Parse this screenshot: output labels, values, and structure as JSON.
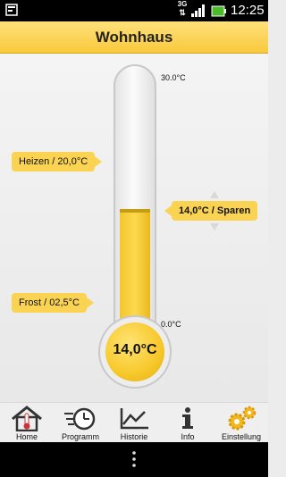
{
  "status_bar": {
    "network": "3G",
    "time": "12:25"
  },
  "title": "Wohnhaus",
  "thermometer": {
    "max_label": "30.0°C",
    "min_label": "0.0°C",
    "current": "14,0°C",
    "current_value": 14.0,
    "scale_min": 0.0,
    "scale_max": 30.0,
    "fill_color": "#fbd352"
  },
  "labels": {
    "heizen": "Heizen / 20,0°C",
    "sparen": "14,0°C / Sparen",
    "frost": "Frost / 02,5°C"
  },
  "nav": [
    {
      "label": "Home",
      "icon": "home-thermometer-icon"
    },
    {
      "label": "Programm",
      "icon": "clock-program-icon"
    },
    {
      "label": "Historie",
      "icon": "chart-history-icon"
    },
    {
      "label": "Info",
      "icon": "info-icon"
    },
    {
      "label": "Einstellung",
      "icon": "gears-icon"
    }
  ]
}
